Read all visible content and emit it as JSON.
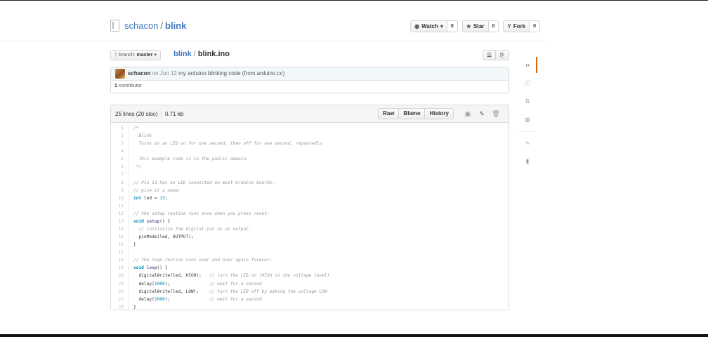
{
  "repo": {
    "owner": "schacon",
    "separator": "/",
    "name": "blink"
  },
  "actions": {
    "watch_label": "Watch",
    "watch_count": "0",
    "star_label": "Star",
    "star_count": "0",
    "fork_label": "Fork",
    "fork_count": "0"
  },
  "file_nav": {
    "branch_prefix": "branch:",
    "branch_name": "master",
    "breadcrumb_repo": "blink",
    "breadcrumb_sep": "/",
    "file_name": "blink.ino"
  },
  "commit": {
    "author": "schacon",
    "date": "on Jun 12",
    "message": "my arduino blinking code (from arduino.cc)",
    "contributors_count": "1",
    "contributors_label": "contributor"
  },
  "file_info": {
    "lines": "25 lines (20 sloc)",
    "size": "0.71 kb",
    "raw_label": "Raw",
    "blame_label": "Blame",
    "history_label": "History"
  },
  "code_lines": [
    "/*",
    "  Blink",
    "  Turns on an LED on for one second, then off for one second, repeatedly.",
    "",
    "  This example code is in the public domain.",
    " */",
    "",
    "// Pin 13 has an LED connected on most Arduino boards.",
    "// give it a name:",
    "int led = 13;",
    "",
    "// the setup routine runs once when you press reset:",
    "void setup() {",
    "  // initialize the digital pin as an output.",
    "  pinMode(led, OUTPUT);",
    "}",
    "",
    "// the loop routine runs over and over again forever:",
    "void loop() {",
    "  digitalWrite(led, HIGH);   // turn the LED on (HIGH is the voltage level)",
    "  delay(1000);               // wait for a second",
    "  digitalWrite(led, LOW);    // turn the LED off by making the voltage LOW",
    "  delay(1000);               // wait for a second",
    "}"
  ],
  "sidebar": {
    "items": [
      {
        "icon": "code-icon",
        "glyph": "‹›",
        "active": true
      },
      {
        "icon": "issue-icon",
        "glyph": "ⓘ",
        "active": false
      },
      {
        "icon": "pull-request-icon",
        "glyph": "⇅",
        "active": false
      },
      {
        "icon": "wiki-icon",
        "glyph": "▥",
        "active": false
      },
      {
        "icon": "pulse-icon",
        "glyph": "∿",
        "active": false
      },
      {
        "icon": "graph-icon",
        "glyph": "▮",
        "active": false
      }
    ]
  },
  "colors": {
    "link": "#4078c0",
    "active_tab": "#d26911",
    "commit_bg": "#f2f8fa"
  }
}
